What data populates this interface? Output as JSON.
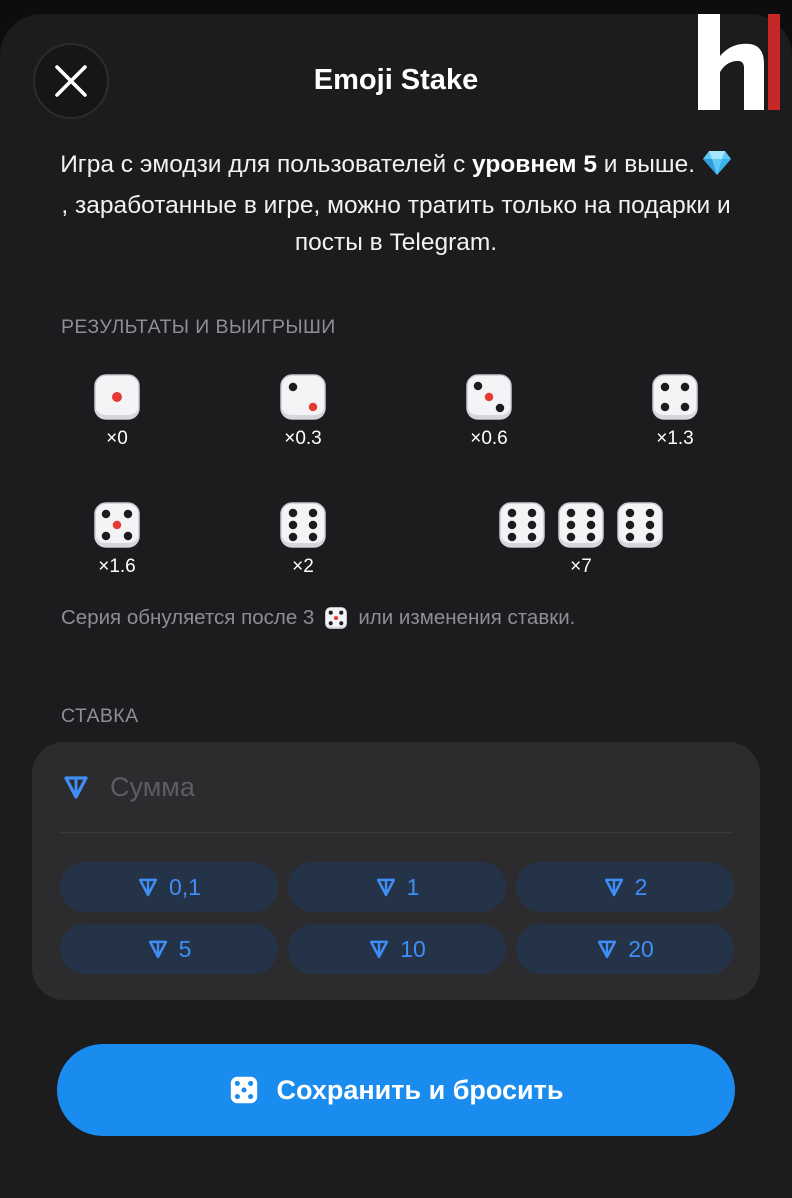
{
  "header": {
    "title": "Emoji Stake",
    "close_icon": "close-icon"
  },
  "brand": {
    "logo_icon": "h-logo",
    "colors": {
      "white": "#ffffff",
      "red": "#c62828"
    }
  },
  "intro": {
    "part1": "Игра с эмодзи для пользователей с ",
    "bold1": "уровнем 5",
    "part2": " и выше. ",
    "diamond_icon": "diamond-icon",
    "part3": ", заработанные в игре, можно тратить только на подарки и посты в Telegram."
  },
  "results": {
    "label": "РЕЗУЛЬТАТЫ И ВЫИГРЫШИ",
    "items": [
      {
        "dice_value": 1,
        "multiplier": "×0"
      },
      {
        "dice_value": 2,
        "multiplier": "×0.3"
      },
      {
        "dice_value": 3,
        "multiplier": "×0.6"
      },
      {
        "dice_value": 4,
        "multiplier": "×1.3"
      },
      {
        "dice_value": 5,
        "multiplier": "×1.6"
      },
      {
        "dice_value": 6,
        "multiplier": "×2"
      },
      {
        "dice_value": 6,
        "count": 3,
        "multiplier": "×7"
      }
    ],
    "note_before": "Серия обнуляется после 3",
    "note_icon": "dice-icon",
    "note_after": "или изменения ставки."
  },
  "stake": {
    "label": "СТАВКА",
    "currency_icon": "ton-icon",
    "amount_value": "",
    "amount_placeholder": "Сумма",
    "presets": [
      "0,1",
      "1",
      "2",
      "5",
      "10",
      "20"
    ]
  },
  "cta": {
    "label": "Сохранить и бросить",
    "icon": "dice-icon"
  },
  "colors": {
    "background": "#1c1c1e",
    "card": "#2c2c2e",
    "accent": "#1a8cf0",
    "ton_blue": "#3f8ef5",
    "preset_bg": "#253348",
    "muted_text": "#8e8e93",
    "dice_red_pip": "#e53935"
  }
}
